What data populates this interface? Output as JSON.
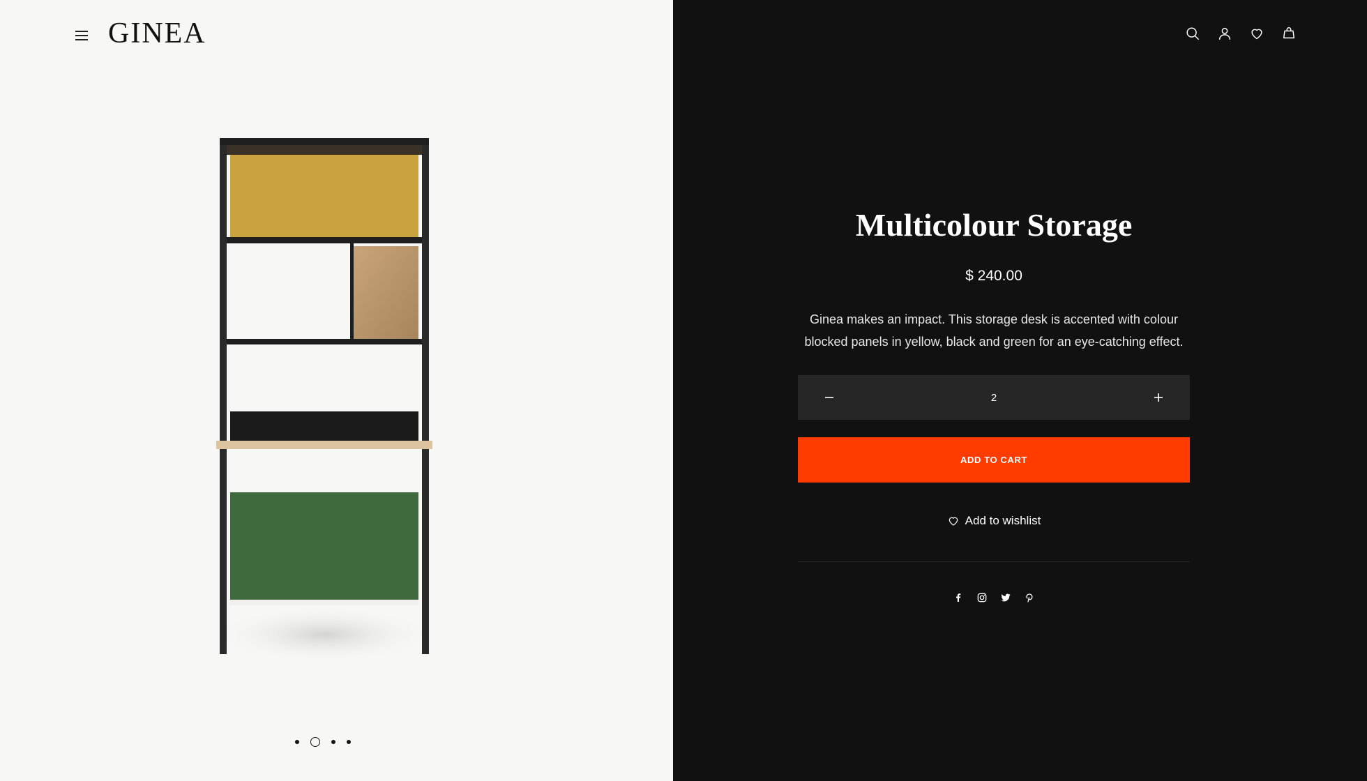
{
  "brand": {
    "logo_text": "GINEA"
  },
  "header": {
    "icons": [
      "search-icon",
      "account-icon",
      "wishlist-heart-icon",
      "cart-bag-icon"
    ]
  },
  "product": {
    "title": "Multicolour Storage",
    "price": "$ 240.00",
    "description": "Ginea makes an impact. This storage desk is accented with colour blocked panels in yellow, black and green for an eye-catching effect.",
    "quantity": "2",
    "add_to_cart_label": "ADD TO CART",
    "wishlist_label": "Add to wishlist"
  },
  "gallery": {
    "total_images": 4,
    "active_index": 1
  },
  "social": [
    "facebook-icon",
    "instagram-icon",
    "twitter-icon",
    "pinterest-icon"
  ],
  "colors": {
    "left_background": "#f7f7f5",
    "right_background": "#111111",
    "accent": "#ff3c00",
    "quantity_bg": "#262626"
  }
}
